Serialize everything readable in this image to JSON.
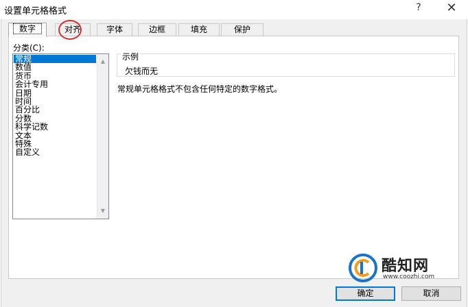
{
  "window": {
    "title": "设置单元格格式",
    "help_label": "?",
    "close_label": "✕"
  },
  "tabs": [
    {
      "label": "数字",
      "active": true
    },
    {
      "label": "对齐",
      "active": false,
      "annotated": true
    },
    {
      "label": "字体",
      "active": false
    },
    {
      "label": "边框",
      "active": false
    },
    {
      "label": "填充",
      "active": false
    },
    {
      "label": "保护",
      "active": false
    }
  ],
  "category": {
    "label": "分类(C):",
    "items": [
      "常规",
      "数值",
      "货币",
      "会计专用",
      "日期",
      "时间",
      "百分比",
      "分数",
      "科学记数",
      "文本",
      "特殊",
      "自定义"
    ],
    "selected": "常规"
  },
  "sample": {
    "title": "示例",
    "value": "欠钱而无"
  },
  "description": "常规单元格格式不包含任何特定的数字格式。",
  "buttons": {
    "ok": "确定",
    "cancel": "取消"
  },
  "watermark": {
    "name": "酷知网",
    "url": "www.coozhi.com"
  },
  "colors": {
    "selection": "#0078d7",
    "annotation": "#d43030",
    "watermark_blue": "#1a73c9",
    "watermark_orange": "#f39c1e"
  }
}
